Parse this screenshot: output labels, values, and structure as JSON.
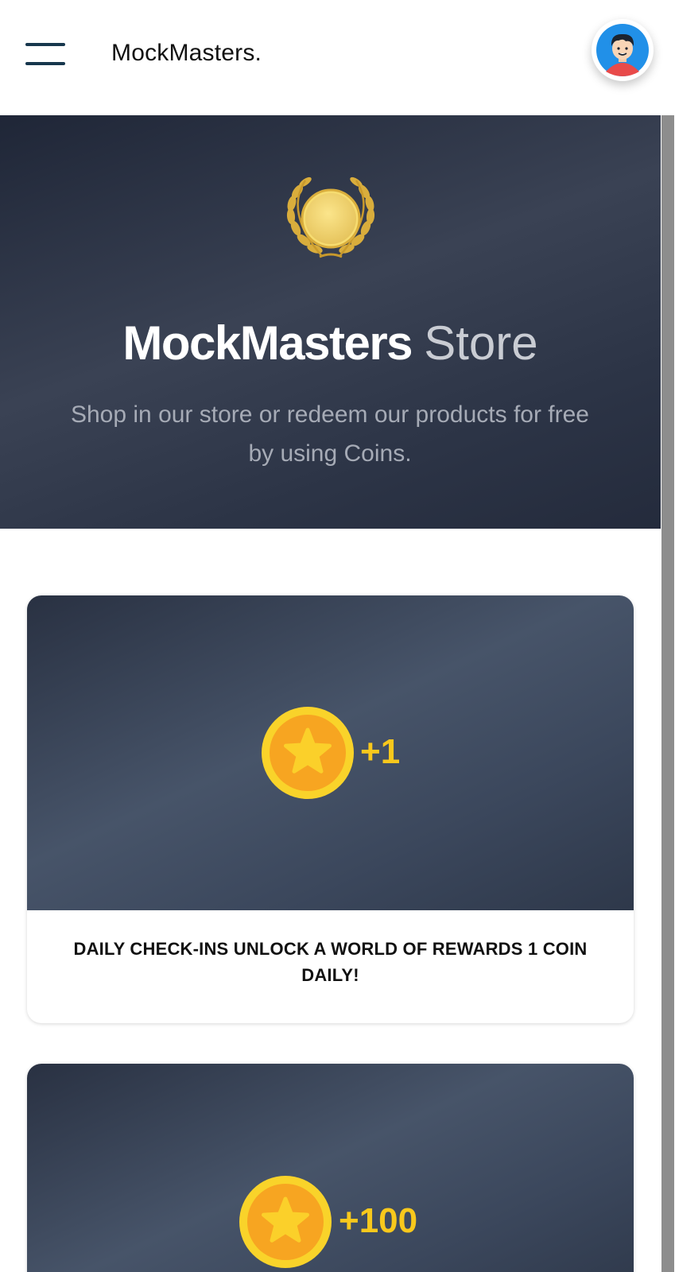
{
  "header": {
    "menu_icon": "hamburger-icon",
    "brand": "MockMasters.",
    "avatar_icon": "user-avatar-icon"
  },
  "hero": {
    "icon": "laurel-wreath-coin-icon",
    "title_bold": "MockMasters",
    "title_light": "Store",
    "subtitle": "Shop in our store or redeem our products for free by using Coins."
  },
  "cards": [
    {
      "coin_icon": "star-coin-icon",
      "amount": "+1",
      "text": "DAILY CHECK-INS UNLOCK A WORLD OF REWARDS 1 COIN DAILY!"
    },
    {
      "coin_icon": "star-coin-icon",
      "amount": "+100",
      "text": ""
    }
  ],
  "colors": {
    "hero_bg": "#2c3446",
    "card_bg": "#3b475c",
    "coin_amount": "#f8c81c",
    "menu_lines": "#17374d"
  }
}
